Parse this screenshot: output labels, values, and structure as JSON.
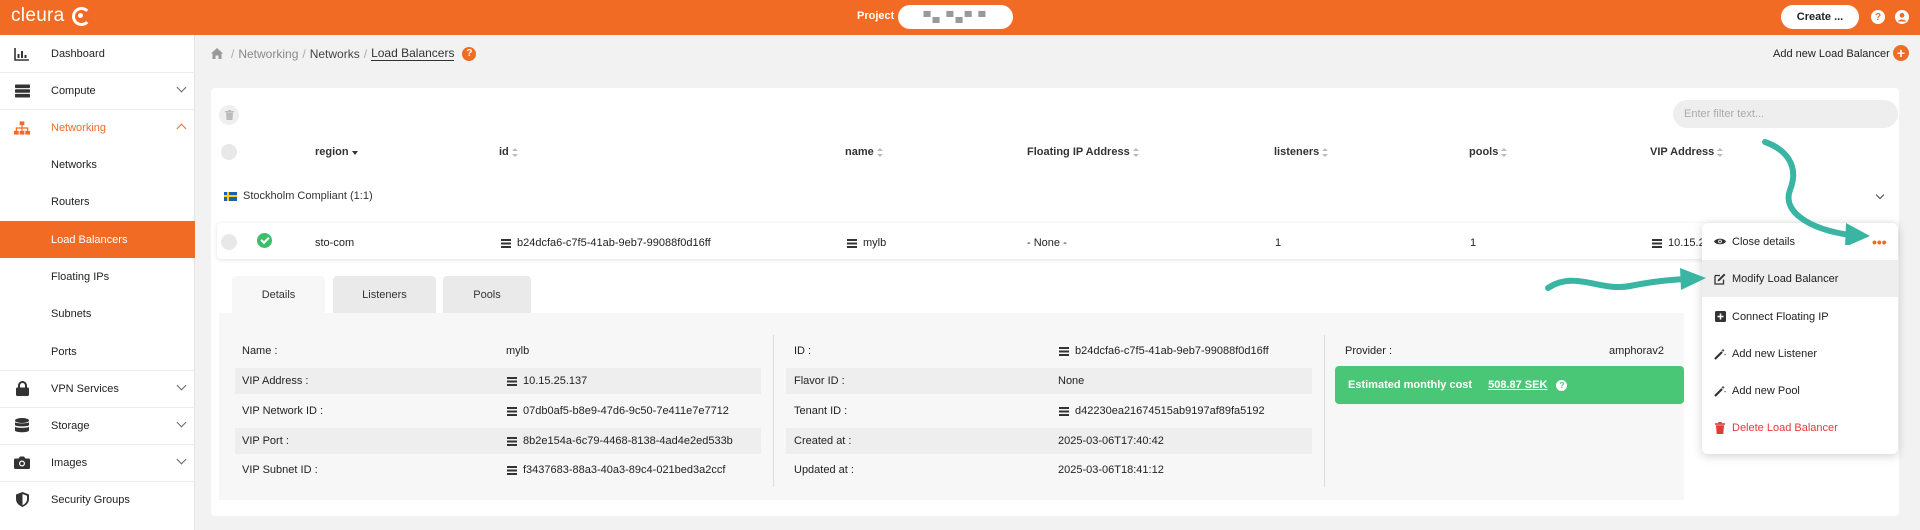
{
  "topbar": {
    "brand": "cleura",
    "project_label": "Project",
    "project_value": "▀▄ ▀▄▀ ▀",
    "create_label": "Create ...",
    "help_glyph": "?"
  },
  "sidebar": {
    "items": [
      {
        "label": "Dashboard",
        "icon": "dashboard-icon"
      },
      {
        "label": "Compute",
        "icon": "server-icon"
      },
      {
        "label": "Networking",
        "icon": "network-icon"
      },
      {
        "label": "Networks"
      },
      {
        "label": "Routers"
      },
      {
        "label": "Load Balancers"
      },
      {
        "label": "Floating IPs"
      },
      {
        "label": "Subnets"
      },
      {
        "label": "Ports"
      },
      {
        "label": "VPN Services",
        "icon": "lock-icon"
      },
      {
        "label": "Storage",
        "icon": "database-icon"
      },
      {
        "label": "Images",
        "icon": "camera-icon"
      },
      {
        "label": "Security Groups",
        "icon": "shield-icon"
      }
    ]
  },
  "breadcrumb": {
    "items": [
      "Networking",
      "Networks",
      "Load Balancers"
    ],
    "separator": "/"
  },
  "header": {
    "add_label": "Add new Load Balancer",
    "add_glyph": "+"
  },
  "filter": {
    "placeholder": "Enter filter text..."
  },
  "table": {
    "columns": [
      "region",
      "id",
      "name",
      "Floating IP Address",
      "listeners",
      "pools",
      "VIP Address"
    ],
    "group": "Stockholm Compliant (1:1)",
    "row": {
      "region": "sto-com",
      "id": "b24dcfa6-c7f5-41ab-9eb7-99088f0d16ff",
      "name": "mylb",
      "floating_ip": "- None -",
      "listeners": "1",
      "pools": "1",
      "vip_address": "10.15.2"
    }
  },
  "tabs": [
    "Details",
    "Listeners",
    "Pools"
  ],
  "details": {
    "left": [
      {
        "label": "Name :",
        "value": "mylb"
      },
      {
        "label": "VIP Address :",
        "value": "10.15.25.137"
      },
      {
        "label": "VIP Network ID :",
        "value": "07db0af5-b8e9-47d6-9c50-7e411e7e7712"
      },
      {
        "label": "VIP Port :",
        "value": "8b2e154a-6c79-4468-8138-4ad4e2ed533b"
      },
      {
        "label": "VIP Subnet ID :",
        "value": "f3437683-88a3-40a3-89c4-021bed3a2ccf"
      }
    ],
    "middle": [
      {
        "label": "ID :",
        "value": "b24dcfa6-c7f5-41ab-9eb7-99088f0d16ff"
      },
      {
        "label": "Flavor ID :",
        "value": "None"
      },
      {
        "label": "Tenant ID :",
        "value": "d42230ea21674515ab9197af89fa5192"
      },
      {
        "label": "Created at :",
        "value": "2025-03-06T17:40:42"
      },
      {
        "label": "Updated at :",
        "value": "2025-03-06T18:41:12"
      }
    ],
    "right": {
      "provider_label": "Provider :",
      "provider_value": "amphorav2",
      "cost_label": "Estimated monthly cost",
      "cost_value": "508.87 SEK"
    }
  },
  "menu": {
    "trigger": "•••",
    "items": [
      {
        "label": "Close details",
        "icon": "eye-icon"
      },
      {
        "label": "Modify Load Balancer",
        "icon": "edit-icon"
      },
      {
        "label": "Connect Floating IP",
        "icon": "plus-square-icon"
      },
      {
        "label": "Add new Listener",
        "icon": "wand-icon"
      },
      {
        "label": "Add new Pool",
        "icon": "wand-icon"
      },
      {
        "label": "Delete Load Balancer",
        "icon": "trash-icon"
      }
    ]
  },
  "colors": {
    "brand": "#f26b25",
    "success": "#4ac776",
    "danger": "#e23a3a",
    "annotation_arrow": "#3bb5a3"
  }
}
